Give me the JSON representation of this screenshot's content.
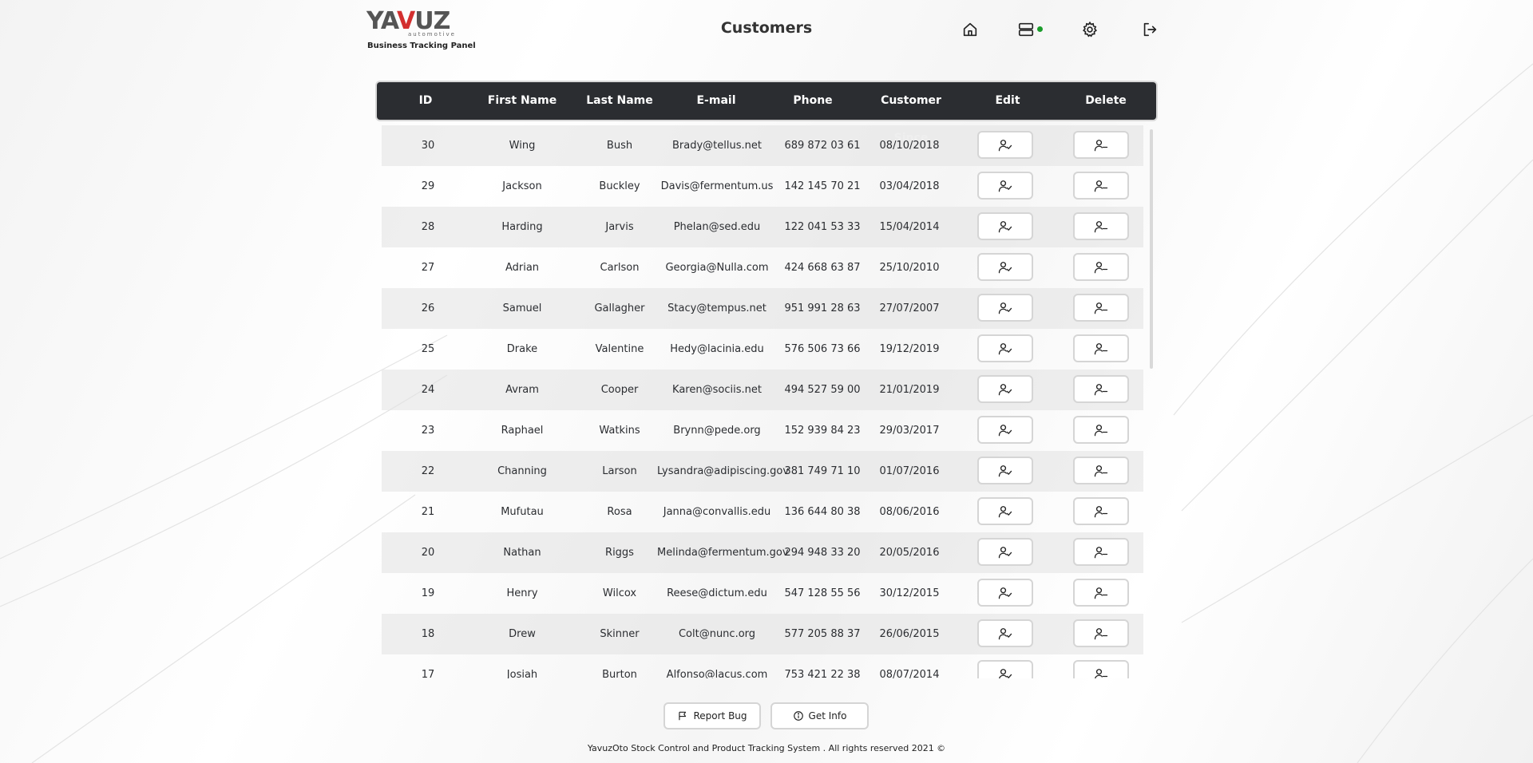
{
  "brand": {
    "logo_text_a": "YA",
    "logo_text_v": "V",
    "logo_text_b": "UZ",
    "logo_sub": "automotive",
    "tagline": "Business Tracking Panel"
  },
  "page": {
    "title": "Customers"
  },
  "header_icons": [
    "home-icon",
    "server-icon",
    "gear-icon",
    "logout-icon"
  ],
  "colors": {
    "header_bg": "#2b2d31",
    "status_online": "#1a9c2a",
    "logo_accent": "#d32f2f"
  },
  "table": {
    "columns": [
      "ID",
      "First Name",
      "Last Name",
      "E-mail",
      "Phone",
      "Customer Since",
      "Edit",
      "Delete"
    ],
    "rows": [
      {
        "id": "30",
        "first": "Wing",
        "last": "Bush",
        "email": "Brady@tellus.net",
        "phone": "689 872 03 61",
        "since": "08/10/2018"
      },
      {
        "id": "29",
        "first": "Jackson",
        "last": "Buckley",
        "email": "Davis@fermentum.us",
        "phone": "142 145 70 21",
        "since": "03/04/2018"
      },
      {
        "id": "28",
        "first": "Harding",
        "last": "Jarvis",
        "email": "Phelan@sed.edu",
        "phone": "122 041 53 33",
        "since": "15/04/2014"
      },
      {
        "id": "27",
        "first": "Adrian",
        "last": "Carlson",
        "email": "Georgia@Nulla.com",
        "phone": "424 668 63 87",
        "since": "25/10/2010"
      },
      {
        "id": "26",
        "first": "Samuel",
        "last": "Gallagher",
        "email": "Stacy@tempus.net",
        "phone": "951 991 28 63",
        "since": "27/07/2007"
      },
      {
        "id": "25",
        "first": "Drake",
        "last": "Valentine",
        "email": "Hedy@lacinia.edu",
        "phone": "576 506 73 66",
        "since": "19/12/2019"
      },
      {
        "id": "24",
        "first": "Avram",
        "last": "Cooper",
        "email": "Karen@sociis.net",
        "phone": "494 527 59 00",
        "since": "21/01/2019"
      },
      {
        "id": "23",
        "first": "Raphael",
        "last": "Watkins",
        "email": "Brynn@pede.org",
        "phone": "152 939 84 23",
        "since": "29/03/2017"
      },
      {
        "id": "22",
        "first": "Channing",
        "last": "Larson",
        "email": "Lysandra@adipiscing.gov",
        "phone": "381 749 71 10",
        "since": "01/07/2016"
      },
      {
        "id": "21",
        "first": "Mufutau",
        "last": "Rosa",
        "email": "Janna@convallis.edu",
        "phone": "136 644 80 38",
        "since": "08/06/2016"
      },
      {
        "id": "20",
        "first": "Nathan",
        "last": "Riggs",
        "email": "Melinda@fermentum.gov",
        "phone": "294 948 33 20",
        "since": "20/05/2016"
      },
      {
        "id": "19",
        "first": "Henry",
        "last": "Wilcox",
        "email": "Reese@dictum.edu",
        "phone": "547 128 55 56",
        "since": "30/12/2015"
      },
      {
        "id": "18",
        "first": "Drew",
        "last": "Skinner",
        "email": "Colt@nunc.org",
        "phone": "577 205 88 37",
        "since": "26/06/2015"
      },
      {
        "id": "17",
        "first": "Josiah",
        "last": "Burton",
        "email": "Alfonso@lacus.com",
        "phone": "753 421 22 38",
        "since": "08/07/2014"
      }
    ]
  },
  "footer": {
    "report_bug": "Report Bug",
    "get_info": "Get Info",
    "copyright": "YavuzOto Stock Control and Product Tracking System . All rights reserved 2021 ©"
  }
}
